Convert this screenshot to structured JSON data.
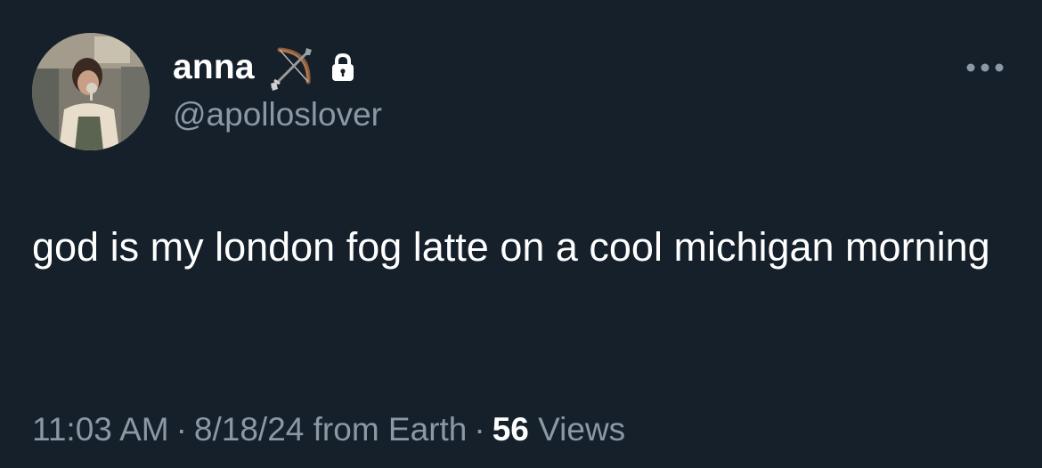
{
  "tweet": {
    "author": {
      "display_name": "anna",
      "handle": "@apolloslover",
      "name_emoji": "bow-and-arrow-icon",
      "protected_badge": "lock-icon"
    },
    "more_button": "more-options-icon",
    "text": "god is my london fog latte on a cool michigan morning",
    "meta": {
      "time": "11:03 AM",
      "separator": "·",
      "date": "8/18/24",
      "source": "from Earth",
      "views_count": "56",
      "views_label": "Views"
    }
  },
  "colors": {
    "background": "#15202b",
    "primary_text": "#ffffff",
    "secondary_text": "#8b98a5"
  }
}
